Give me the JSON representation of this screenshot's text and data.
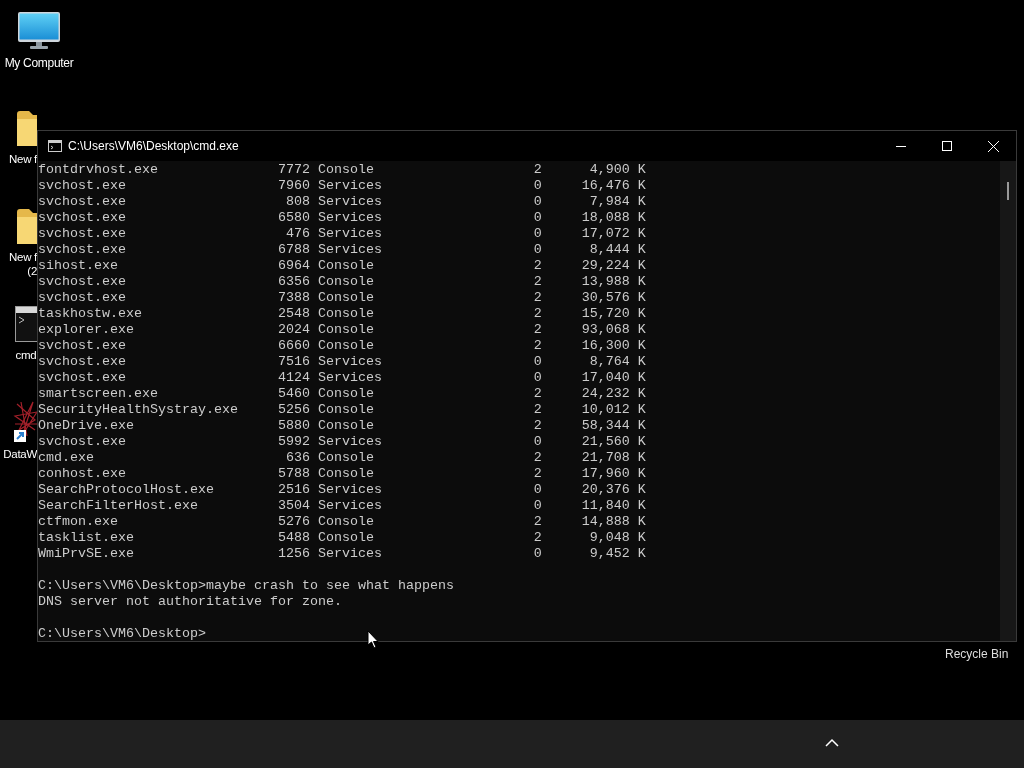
{
  "desktop_icons": [
    {
      "kind": "computer",
      "label": "My Computer"
    },
    {
      "kind": "folder",
      "label": "New f"
    },
    {
      "kind": "folder",
      "label": "New f",
      "label_line_2": "(2"
    },
    {
      "kind": "console",
      "label": "cmd"
    },
    {
      "kind": "app",
      "label": "DataW"
    }
  ],
  "recycle_bin": {
    "label": "Recycle Bin"
  },
  "window": {
    "title": "C:\\Users\\VM6\\Desktop\\cmd.exe",
    "process_rows": [
      {
        "image": "fontdrvhost.exe",
        "pid": "7772",
        "session": "Console",
        "session_number": "2",
        "memory": "4,900 K"
      },
      {
        "image": "svchost.exe",
        "pid": "7960",
        "session": "Services",
        "session_number": "0",
        "memory": "16,476 K"
      },
      {
        "image": "svchost.exe",
        "pid": "808",
        "session": "Services",
        "session_number": "0",
        "memory": "7,984 K"
      },
      {
        "image": "svchost.exe",
        "pid": "6580",
        "session": "Services",
        "session_number": "0",
        "memory": "18,088 K"
      },
      {
        "image": "svchost.exe",
        "pid": "476",
        "session": "Services",
        "session_number": "0",
        "memory": "17,072 K"
      },
      {
        "image": "svchost.exe",
        "pid": "6788",
        "session": "Services",
        "session_number": "0",
        "memory": "8,444 K"
      },
      {
        "image": "sihost.exe",
        "pid": "6964",
        "session": "Console",
        "session_number": "2",
        "memory": "29,224 K"
      },
      {
        "image": "svchost.exe",
        "pid": "6356",
        "session": "Console",
        "session_number": "2",
        "memory": "13,988 K"
      },
      {
        "image": "svchost.exe",
        "pid": "7388",
        "session": "Console",
        "session_number": "2",
        "memory": "30,576 K"
      },
      {
        "image": "taskhostw.exe",
        "pid": "2548",
        "session": "Console",
        "session_number": "2",
        "memory": "15,720 K"
      },
      {
        "image": "explorer.exe",
        "pid": "2024",
        "session": "Console",
        "session_number": "2",
        "memory": "93,068 K"
      },
      {
        "image": "svchost.exe",
        "pid": "6660",
        "session": "Console",
        "session_number": "2",
        "memory": "16,300 K"
      },
      {
        "image": "svchost.exe",
        "pid": "7516",
        "session": "Services",
        "session_number": "0",
        "memory": "8,764 K"
      },
      {
        "image": "svchost.exe",
        "pid": "4124",
        "session": "Services",
        "session_number": "0",
        "memory": "17,040 K"
      },
      {
        "image": "smartscreen.exe",
        "pid": "5460",
        "session": "Console",
        "session_number": "2",
        "memory": "24,232 K"
      },
      {
        "image": "SecurityHealthSystray.exe",
        "pid": "5256",
        "session": "Console",
        "session_number": "2",
        "memory": "10,012 K"
      },
      {
        "image": "OneDrive.exe",
        "pid": "5880",
        "session": "Console",
        "session_number": "2",
        "memory": "58,344 K"
      },
      {
        "image": "svchost.exe",
        "pid": "5992",
        "session": "Services",
        "session_number": "0",
        "memory": "21,560 K"
      },
      {
        "image": "cmd.exe",
        "pid": "636",
        "session": "Console",
        "session_number": "2",
        "memory": "21,708 K"
      },
      {
        "image": "conhost.exe",
        "pid": "5788",
        "session": "Console",
        "session_number": "2",
        "memory": "17,960 K"
      },
      {
        "image": "SearchProtocolHost.exe",
        "pid": "2516",
        "session": "Services",
        "session_number": "0",
        "memory": "20,376 K"
      },
      {
        "image": "SearchFilterHost.exe",
        "pid": "3504",
        "session": "Services",
        "session_number": "0",
        "memory": "11,840 K"
      },
      {
        "image": "ctfmon.exe",
        "pid": "5276",
        "session": "Console",
        "session_number": "2",
        "memory": "14,888 K"
      },
      {
        "image": "tasklist.exe",
        "pid": "5488",
        "session": "Console",
        "session_number": "2",
        "memory": "9,048 K"
      },
      {
        "image": "WmiPrvSE.exe",
        "pid": "1256",
        "session": "Services",
        "session_number": "0",
        "memory": "9,452 K"
      }
    ],
    "commands": [
      {
        "prompt": "C:\\Users\\VM6\\Desktop>",
        "input": "maybe crash to see what happens",
        "output": "DNS server not authoritative for zone."
      }
    ],
    "current_prompt": "C:\\Users\\VM6\\Desktop>"
  }
}
